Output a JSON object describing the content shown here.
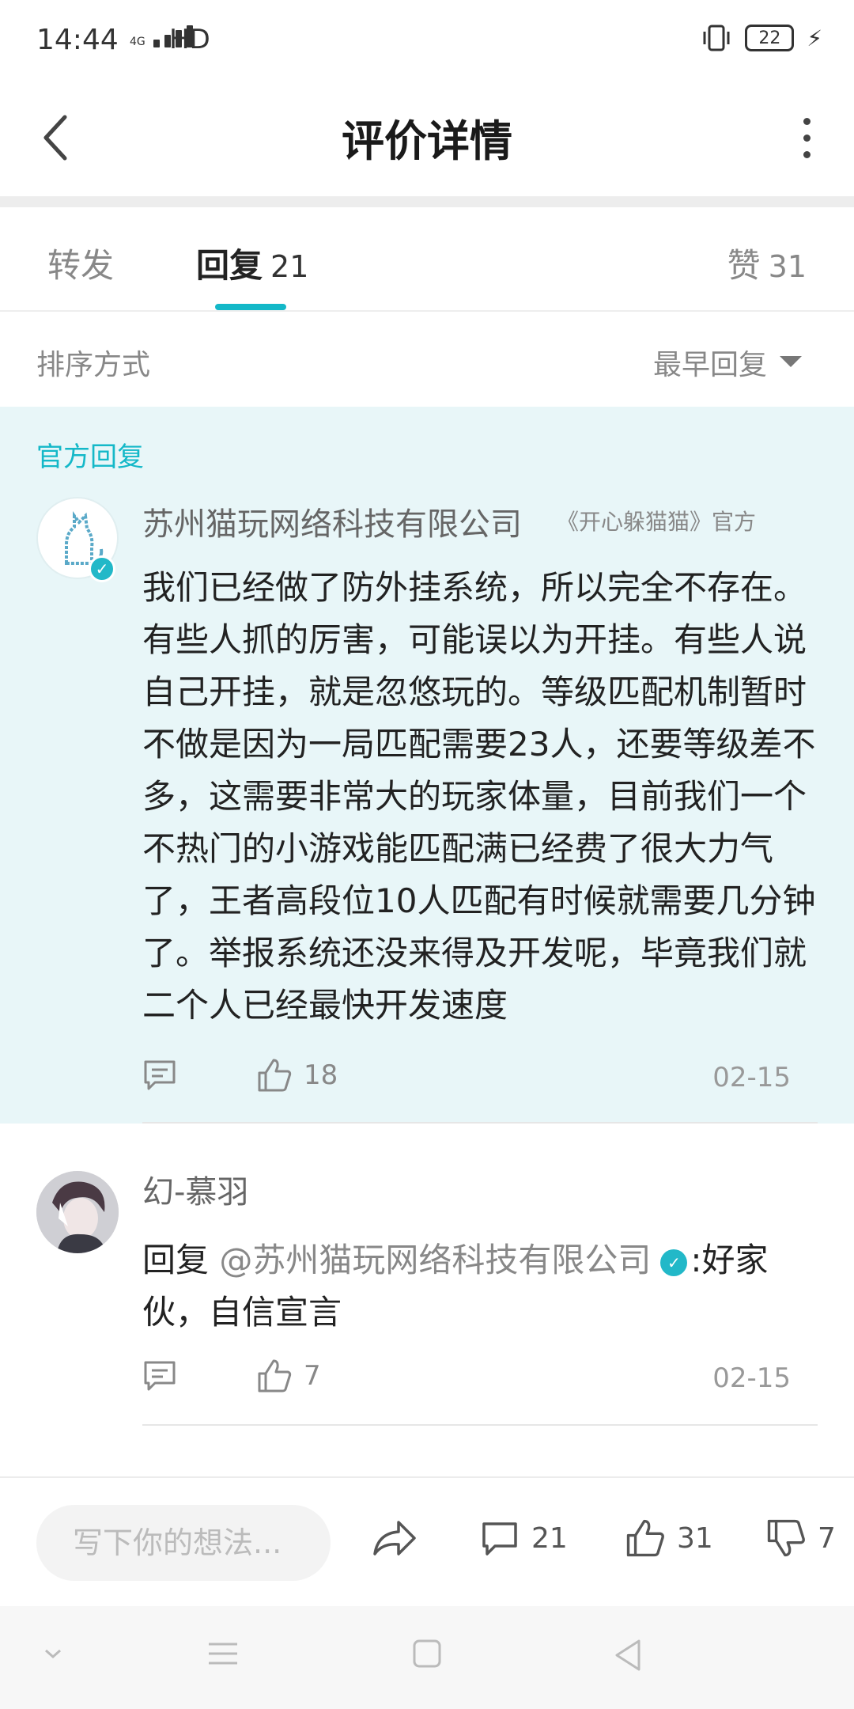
{
  "status_bar": {
    "time": "14:44",
    "network": "4G",
    "hd": "HD",
    "battery": "22"
  },
  "header": {
    "title": "评价详情"
  },
  "tabs": {
    "forward": "转发",
    "reply": "回复",
    "reply_count": "21",
    "like": "赞",
    "like_count": "31"
  },
  "sort": {
    "label": "排序方式",
    "value": "最早回复"
  },
  "official_reply": {
    "label": "官方回复",
    "author": "苏州猫玩网络科技有限公司",
    "tag": "《开心躲猫猫》官方",
    "content": "我们已经做了防外挂系统，所以完全不存在。有些人抓的厉害，可能误以为开挂。有些人说自己开挂，就是忽悠玩的。等级匹配机制暂时不做是因为一局匹配需要23人，还要等级差不多，这需要非常大的玩家体量，目前我们一个不热门的小游戏能匹配满已经费了很大力气了，王者高段位10人匹配有时候就需要几分钟了。举报系统还没来得及开发呢，毕竟我们就二个人已经最快开发速度",
    "likes": "18",
    "date": "02-15"
  },
  "comment": {
    "author": "幻-慕羽",
    "reply_prefix": "回复",
    "mention": "@苏州猫玩网络科技有限公司",
    "text": ":好家伙，自信宣言",
    "likes": "7",
    "date": "02-15"
  },
  "bottom_bar": {
    "input_placeholder": "写下你的想法...",
    "comment_count": "21",
    "like_count": "31",
    "dislike_count": "7"
  },
  "colors": {
    "accent": "#14b8c8",
    "official_bg": "#e8f6f8"
  }
}
